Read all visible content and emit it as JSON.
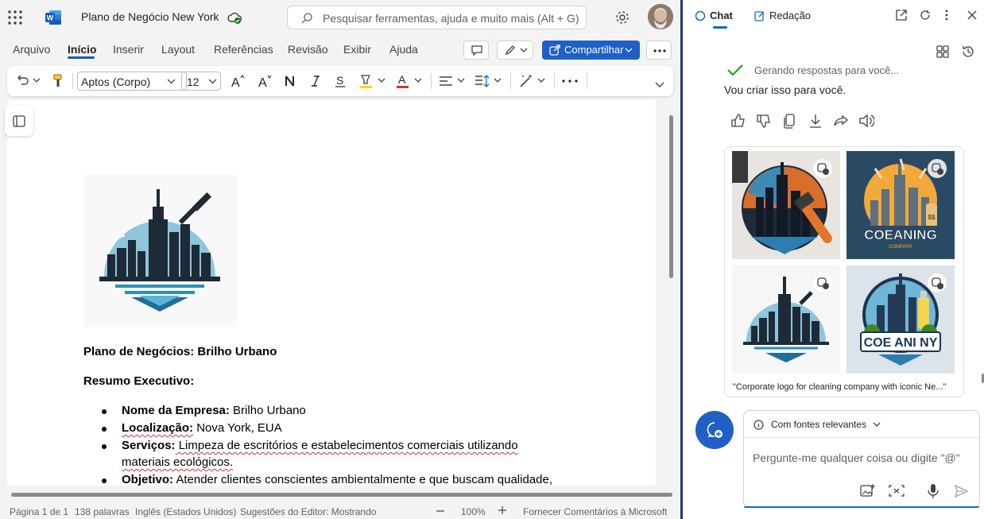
{
  "app": {
    "document_title": "Plano de Negócio New York",
    "search_placeholder": "Pesquisar ferramentas, ajuda e muito mais (Alt + G)"
  },
  "ribbon_tabs": [
    "Arquivo",
    "Início",
    "Inserir",
    "Layout",
    "Referências",
    "Revisão",
    "Exibir",
    "Ajuda"
  ],
  "active_tab": "Início",
  "share_label": "Compartilhar",
  "format": {
    "font_name": "Aptos (Corpo)",
    "font_size": "12",
    "font_color": "#d13438",
    "highlight_color": "#ffd400"
  },
  "document": {
    "heading": "Plano de Negócios: Brilho Urbano",
    "section_title": "Resumo Executivo:",
    "bullets": [
      {
        "label": "Nome da Empresa:",
        "text": " Brilho Urbano"
      },
      {
        "label": "Localização:",
        "text": " Nova York, EUA"
      },
      {
        "label": "Serviços:",
        "text": " Limpeza de escritórios e estabelecimentos comerciais utilizando",
        "cont": "materiais ecológicos."
      },
      {
        "label": "Objetivo:",
        "text": " Atender clientes conscientes ambientalmente e que buscam qualidade,"
      }
    ]
  },
  "status": {
    "page": "Página 1 de 1",
    "words": "138 palavras",
    "language": "Inglês (Estados Unidos)",
    "editor": "Sugestões do Editor: Mostrando",
    "zoom": "100%",
    "feedback": "Fornecer Comentários à Microsoft"
  },
  "copilot": {
    "tab_chat": "Chat",
    "tab_redacao": "Redação",
    "thinking": "Gerando respostas para você...",
    "reply": "Vou criar isso para você.",
    "caption": "\"Corporate logo for cleaning company with iconic Ne...\"",
    "images": [
      {
        "name": "skyline-brush",
        "text": ""
      },
      {
        "name": "coeaning-company",
        "text": "COEANING",
        "subtext": "COMPANY"
      },
      {
        "name": "skyline-squeegee",
        "text": ""
      },
      {
        "name": "coeani-ny",
        "text": "COE ANI NY"
      }
    ],
    "sources_label": "Com fontes relevantes",
    "input_placeholder": "Pergunte-me qualquer coisa ou digite \"@\""
  }
}
